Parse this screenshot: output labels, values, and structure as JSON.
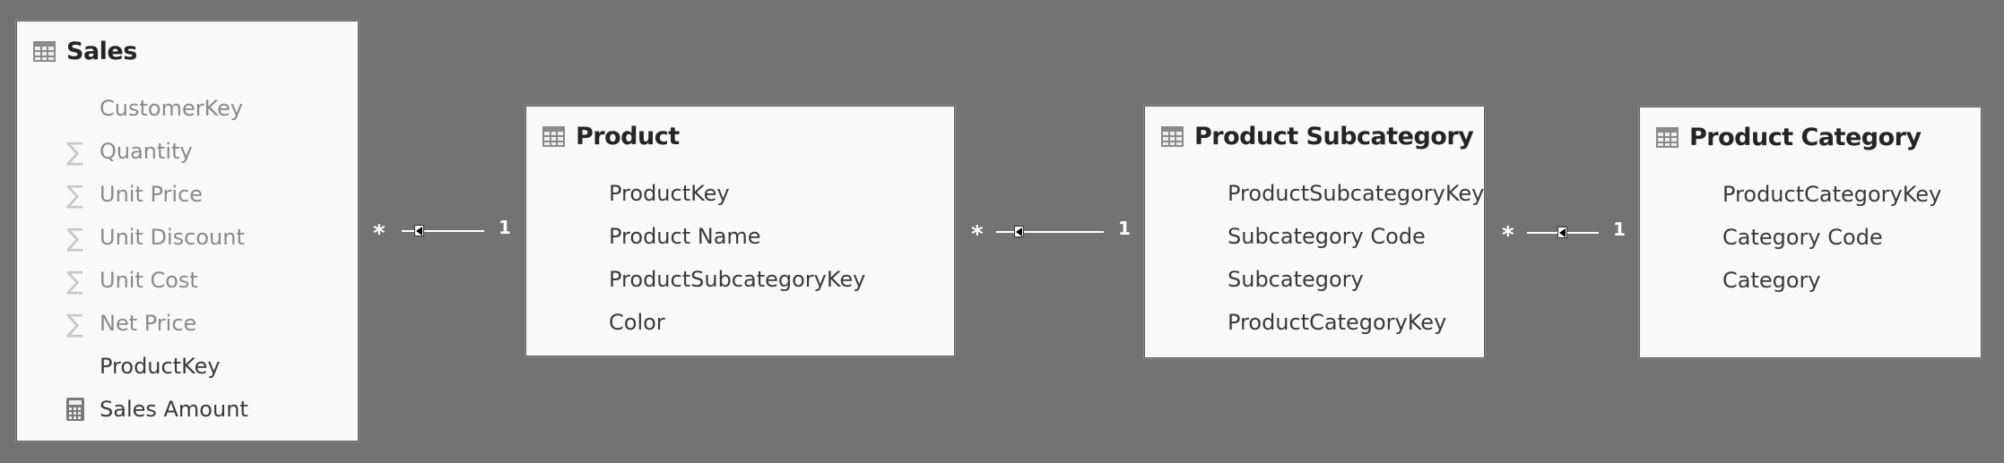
{
  "tables": [
    {
      "name": "Sales",
      "fields": [
        {
          "label": "CustomerKey",
          "icon": "none",
          "hidden": true
        },
        {
          "label": "Quantity",
          "icon": "sigma-icon",
          "hidden": true
        },
        {
          "label": "Unit Price",
          "icon": "sigma-icon",
          "hidden": true
        },
        {
          "label": "Unit Discount",
          "icon": "sigma-icon",
          "hidden": true
        },
        {
          "label": "Unit Cost",
          "icon": "sigma-icon",
          "hidden": true
        },
        {
          "label": "Net Price",
          "icon": "sigma-icon",
          "hidden": true
        },
        {
          "label": "ProductKey",
          "icon": "none",
          "hidden": false
        },
        {
          "label": "Sales Amount",
          "icon": "calculator-icon",
          "hidden": false
        }
      ]
    },
    {
      "name": "Product",
      "fields": [
        {
          "label": "ProductKey",
          "icon": "none",
          "hidden": false
        },
        {
          "label": "Product Name",
          "icon": "none",
          "hidden": false
        },
        {
          "label": "ProductSubcategoryKey",
          "icon": "none",
          "hidden": false
        },
        {
          "label": "Color",
          "icon": "none",
          "hidden": false
        }
      ]
    },
    {
      "name": "Product Subcategory",
      "fields": [
        {
          "label": "ProductSubcategoryKey",
          "icon": "none",
          "hidden": false
        },
        {
          "label": "Subcategory Code",
          "icon": "none",
          "hidden": false
        },
        {
          "label": "Subcategory",
          "icon": "none",
          "hidden": false
        },
        {
          "label": "ProductCategoryKey",
          "icon": "none",
          "hidden": false
        }
      ]
    },
    {
      "name": "Product Category",
      "fields": [
        {
          "label": "ProductCategoryKey",
          "icon": "none",
          "hidden": false
        },
        {
          "label": "Category Code",
          "icon": "none",
          "hidden": false
        },
        {
          "label": "Category",
          "icon": "none",
          "hidden": false
        }
      ]
    }
  ],
  "relationships": [
    {
      "from": "Sales",
      "to": "Product",
      "many_label": "*",
      "one_label": "1"
    },
    {
      "from": "Product",
      "to": "Product Subcategory",
      "many_label": "*",
      "one_label": "1"
    },
    {
      "from": "Product Subcategory",
      "to": "Product Category",
      "many_label": "*",
      "one_label": "1"
    }
  ],
  "colors": {
    "canvas": "#737373",
    "box": "#f9f9f9",
    "title": "#252525",
    "field": "#3a3a3a",
    "hidden_field": "#8a8a8a"
  }
}
